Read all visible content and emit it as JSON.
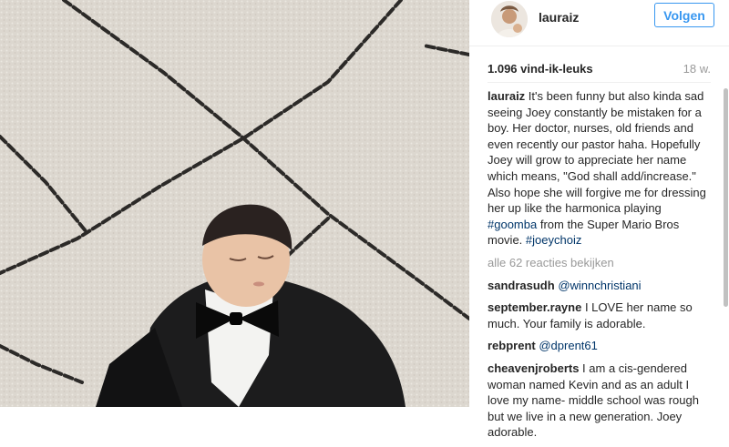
{
  "post": {
    "username": "lauraiz",
    "follow_label": "Volgen",
    "likes": "1.096 vind-ik-leuks",
    "age": "18 w.",
    "caption_user": "lauraiz",
    "caption_text_1": " It's been funny but also kinda sad seeing Joey constantly be mistaken for a boy. Her doctor, nurses, old friends and even recently our pastor haha. Hopefully Joey will grow to appreciate her name which means, \"God shall add/increase.\" Also hope she will forgive me for dressing her up like the harmonica playing ",
    "caption_hashtag_1": "#goomba",
    "caption_text_2": " from the Super Mario Bros movie. ",
    "caption_hashtag_2": "#joeychoiz",
    "view_all_comments": "alle 62 reacties bekijken"
  },
  "comments": [
    {
      "user": "sandrasudh",
      "mention": "@winnchristiani",
      "text": ""
    },
    {
      "user": "september.rayne",
      "mention": "",
      "text": " I LOVE her name so much. Your family is adorable."
    },
    {
      "user": "rebprent",
      "mention": "@dprent61",
      "text": ""
    },
    {
      "user": "cheavenjroberts",
      "mention": "",
      "text": " I am a cis-gendered woman named Kevin and as an adult I love my name- middle school was rough but we live in a new generation. Joey adorable."
    }
  ],
  "colors": {
    "accent": "#3897f0",
    "link": "#003569",
    "muted": "#999999"
  },
  "icons": {
    "avatar": "profile-photo"
  }
}
